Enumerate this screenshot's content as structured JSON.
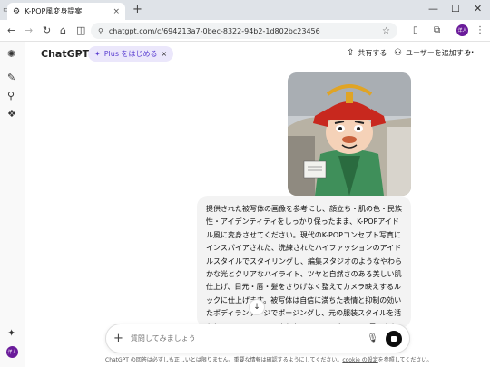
{
  "browser": {
    "tab_title": "K-POP風変身提案",
    "tab_close": "×",
    "new_tab": "+",
    "url": "chatgpt.com/c/694213a7-0bec-8322-94b2-1d802bc23456",
    "window_controls": {
      "minimize": "—",
      "maximize": "☐",
      "close": "✕"
    },
    "avatar_text": "洋人"
  },
  "header": {
    "model_name": "ChatGPT",
    "plus_label": "Plus をはじめる",
    "plus_close": "×",
    "share_label": "共有する",
    "add_user_label": "ユーザーを追加する",
    "more": "···"
  },
  "message": {
    "text": "提供された被写体の画像を参考にし、顔立ち・肌の色・民族性・アイデンティティをしっかり保ったまま、K-POPアイドル風に変身させてください。現代のK-POPコンセプト写真にインスパイアされた、洗練されたハイファッションのアイドルスタイルでスタイリングし、編集スタジオのようなやわらかな光とクリアなハイライト、ツヤと自然さのある美しい肌仕上げ、目元・唇・髪をさりげなく整えてカメラ映えするルックに仕上げます。被写体は自信に満ちた表情と抑制の効いたポディランゲージでポージングし、元の服装スタイルを活かしつつ、エレベートされたストリートウェア、K風アクセント、シックなテーラリング、グラムパンク、ソフトで幻想的な雰囲気など、現代K-POPトレンドを取り入れたファッション性の高い衣装で仕上げます。雰囲気はプロのアイドル"
  },
  "composer": {
    "placeholder": "質問してみましょう",
    "plus": "+"
  },
  "footer": {
    "text_before": "ChatGPT の回答は必ずしも正しいとは限りません。重要な情報は確認するようにしてください。",
    "link": "cookie の設定",
    "text_after": "を参照してください。"
  },
  "colors": {
    "accent": "#5b3fd1",
    "avatar": "#6a1b9a"
  }
}
